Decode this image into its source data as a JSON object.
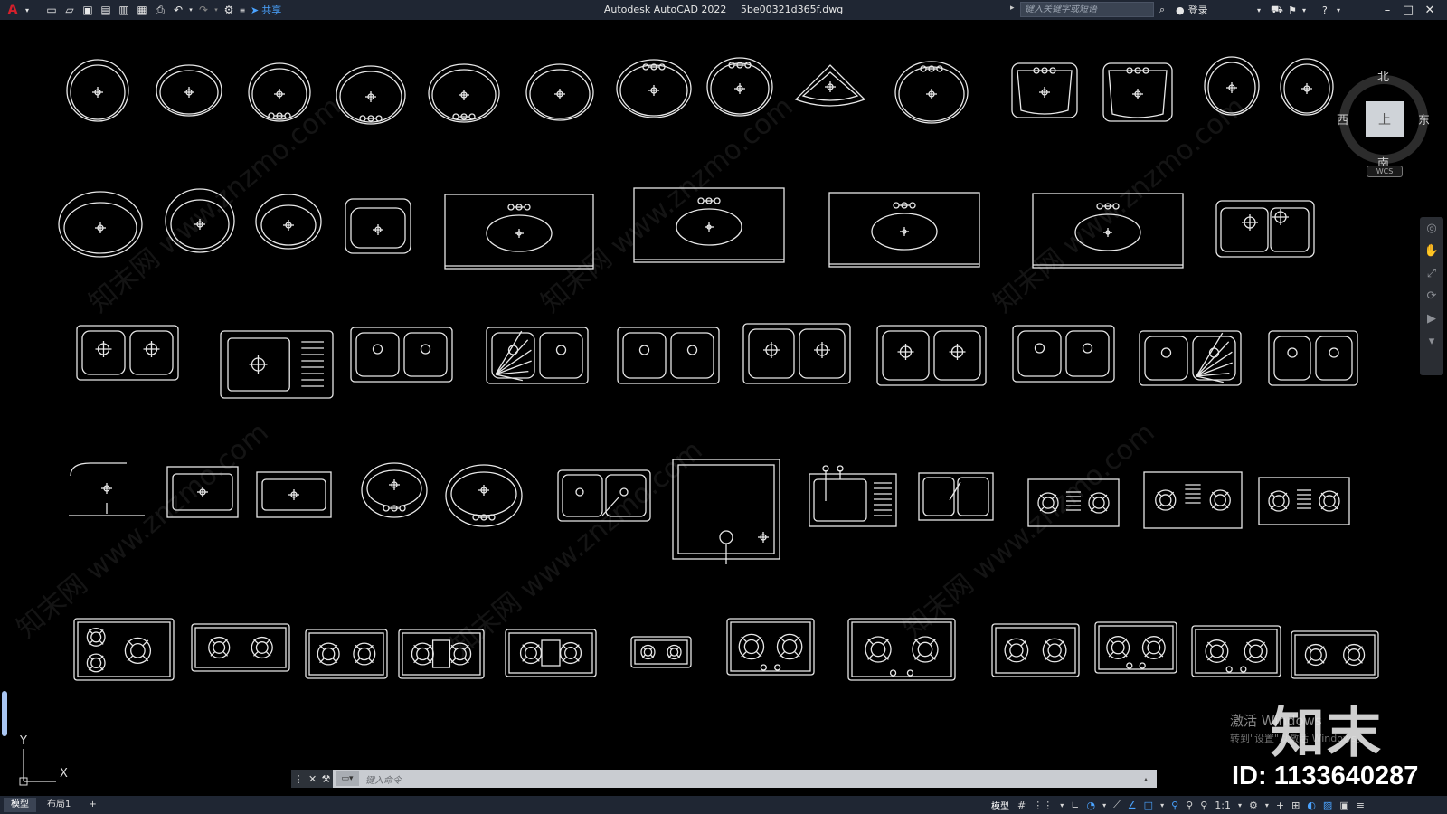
{
  "titlebar": {
    "app_title": "Autodesk AutoCAD 2022",
    "file_name": "5be00321d365f.dwg",
    "share_label": "共享",
    "search_placeholder": "键入关键字或短语",
    "login_label": "登录"
  },
  "viewcube": {
    "north": "北",
    "south": "南",
    "east": "东",
    "west": "西",
    "face": "上",
    "wcs": "WCS"
  },
  "ucs": {
    "x": "X",
    "y": "Y"
  },
  "watermark": {
    "activate_title": "激活 Windows",
    "activate_sub": "转到\"设置\"以激活 Windows。",
    "logo": "知末",
    "id": "ID: 1133640287",
    "site_text": "知末网 www.znzmo.com"
  },
  "commandline": {
    "placeholder": "键入命令"
  },
  "statusbar": {
    "tabs": [
      "模型",
      "布局1"
    ],
    "model_label": "模型",
    "scale": "1:1"
  },
  "colors": {
    "background": "#000000",
    "titlebar": "#1f2633",
    "linework": "#e8e8e8",
    "accent": "#4aa3ff",
    "logo_red": "#d6202b"
  }
}
